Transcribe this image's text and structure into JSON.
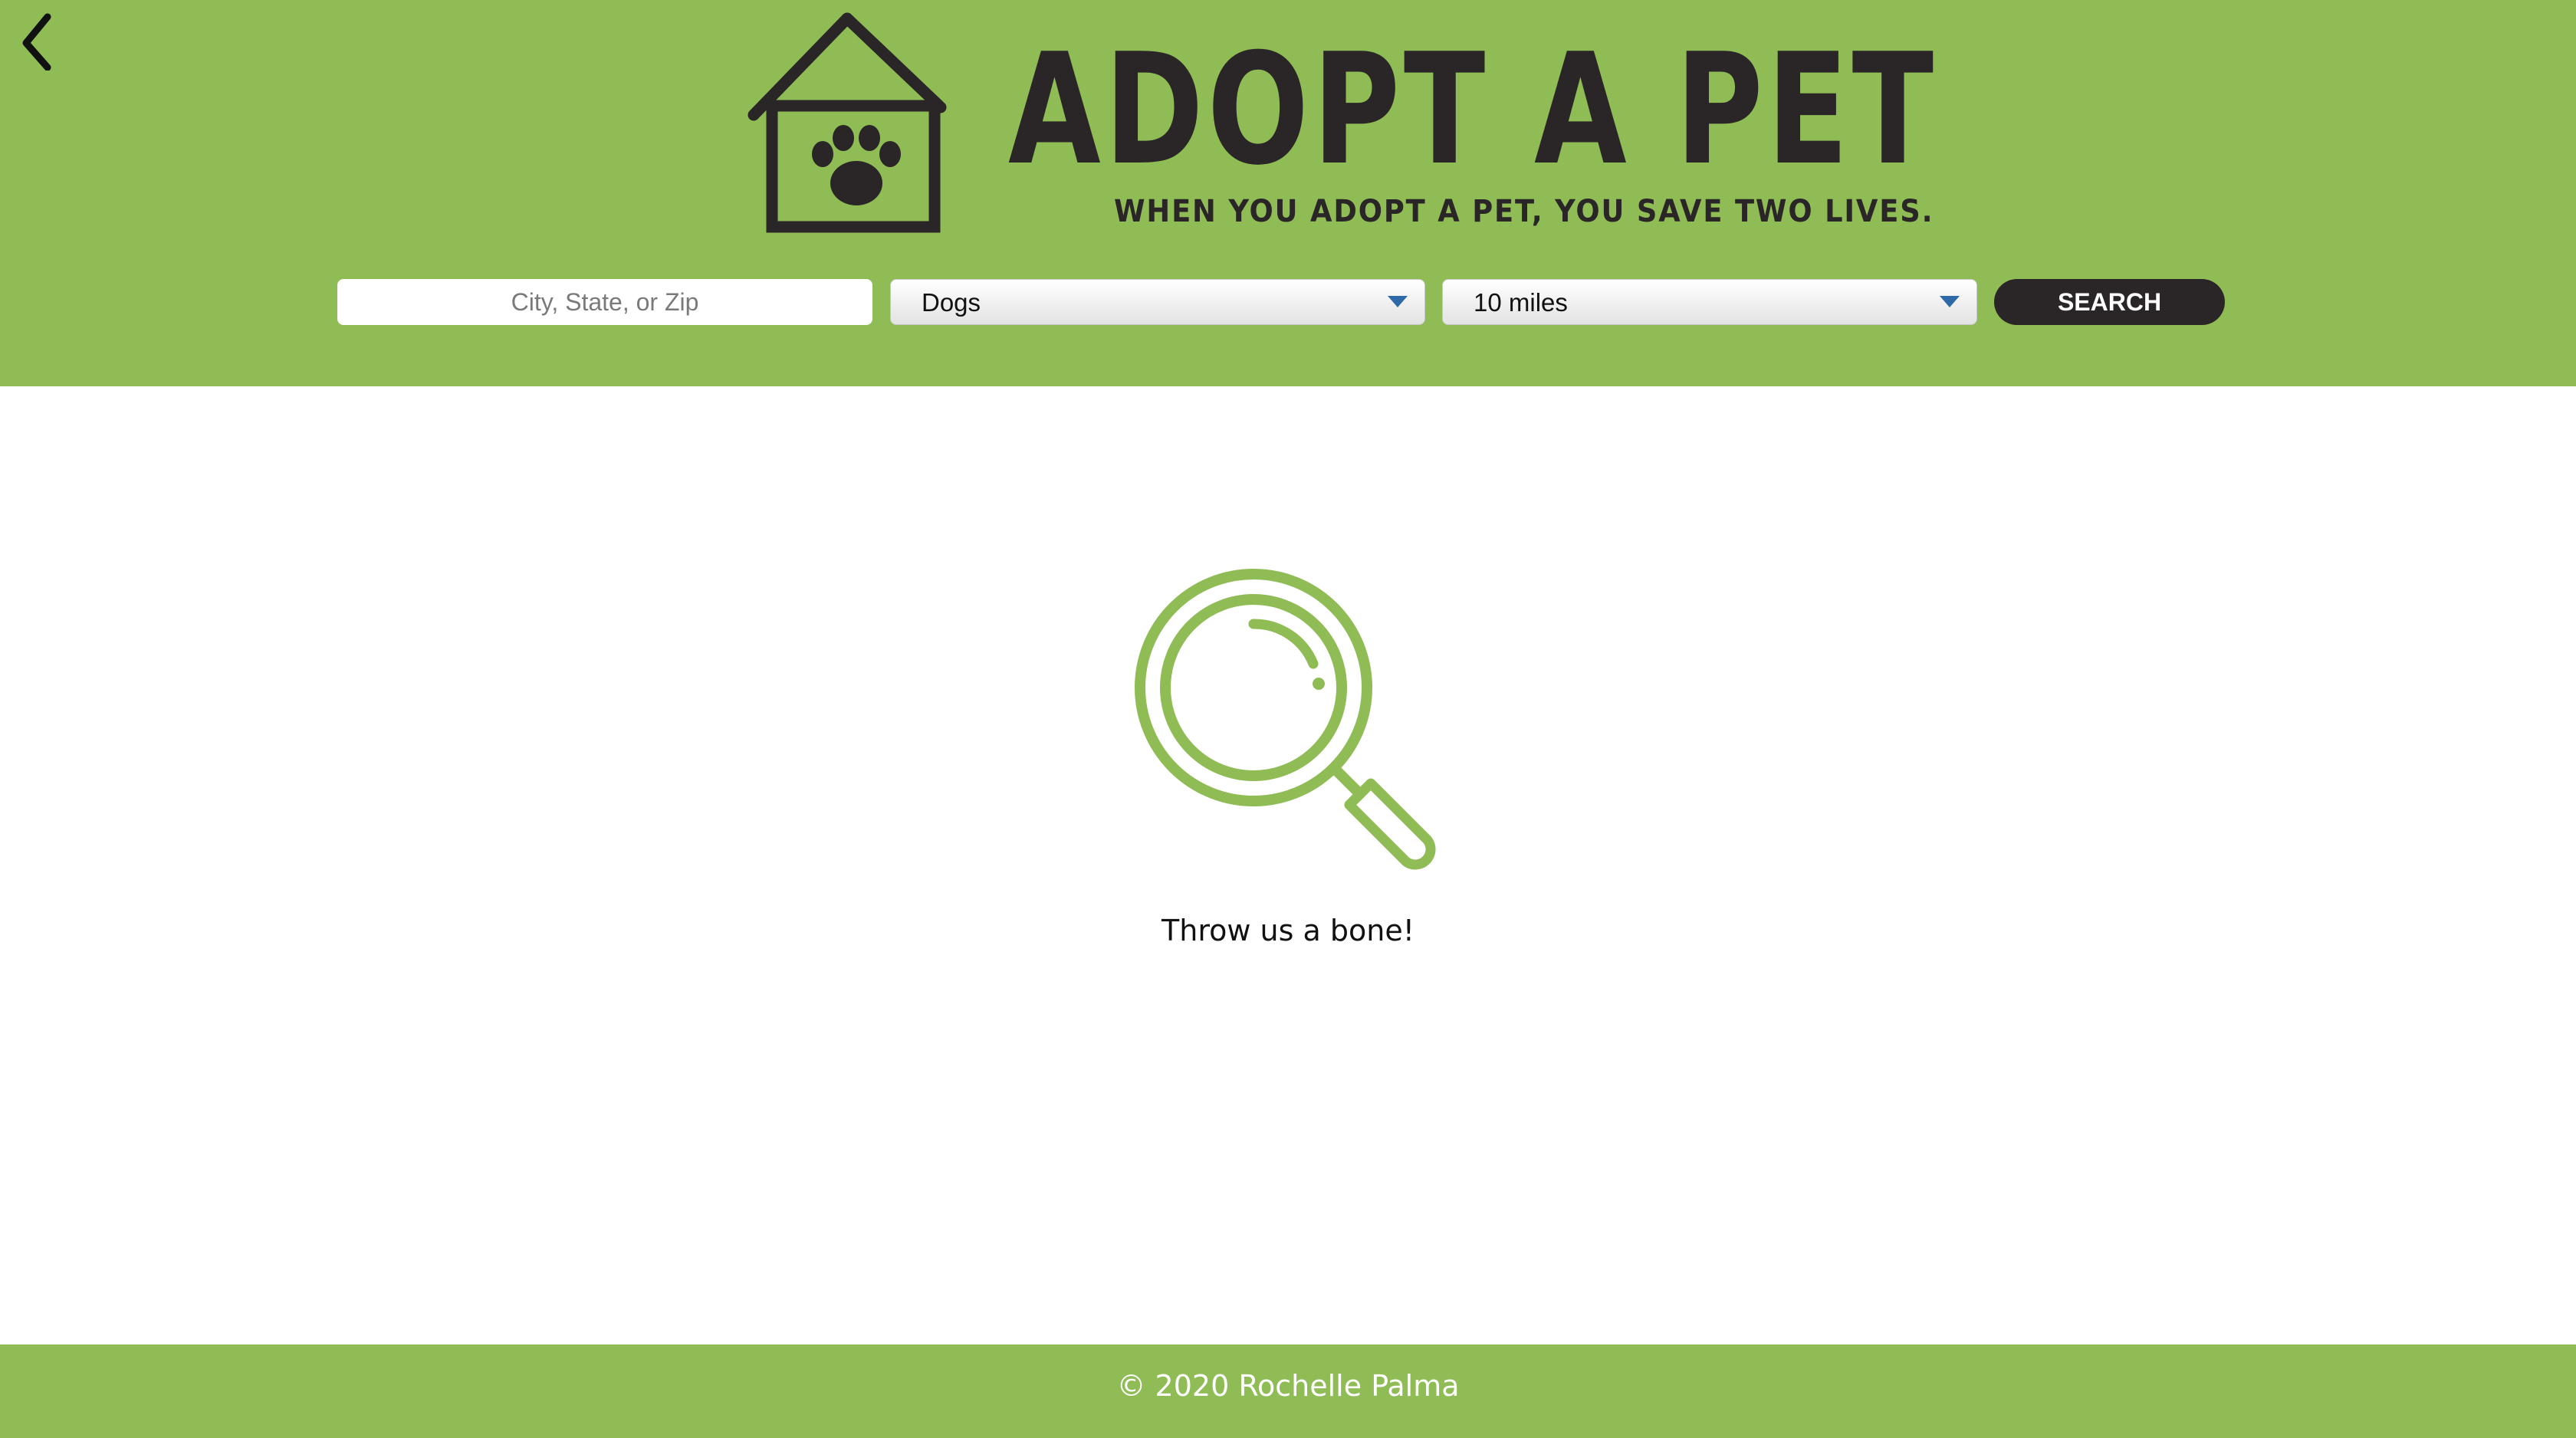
{
  "header": {
    "back_icon": "chevron-left-icon",
    "logo": {
      "icon": "doghouse-paw-icon",
      "title": "ADOPT A PET",
      "tagline": "WHEN YOU ADOPT A PET, YOU SAVE TWO LIVES."
    },
    "search": {
      "location_placeholder": "City, State, or Zip",
      "location_value": "",
      "animal_selected": "Dogs",
      "distance_selected": "10 miles",
      "button_label": "SEARCH"
    }
  },
  "main": {
    "empty_icon": "magnifying-glass-icon",
    "empty_message": "Throw us a bone!"
  },
  "footer": {
    "copyright": "© 2020 Rochelle Palma"
  },
  "colors": {
    "brand_green": "#8fbc55",
    "dark": "#2a2526",
    "select_arrow": "#2f6aa8"
  }
}
